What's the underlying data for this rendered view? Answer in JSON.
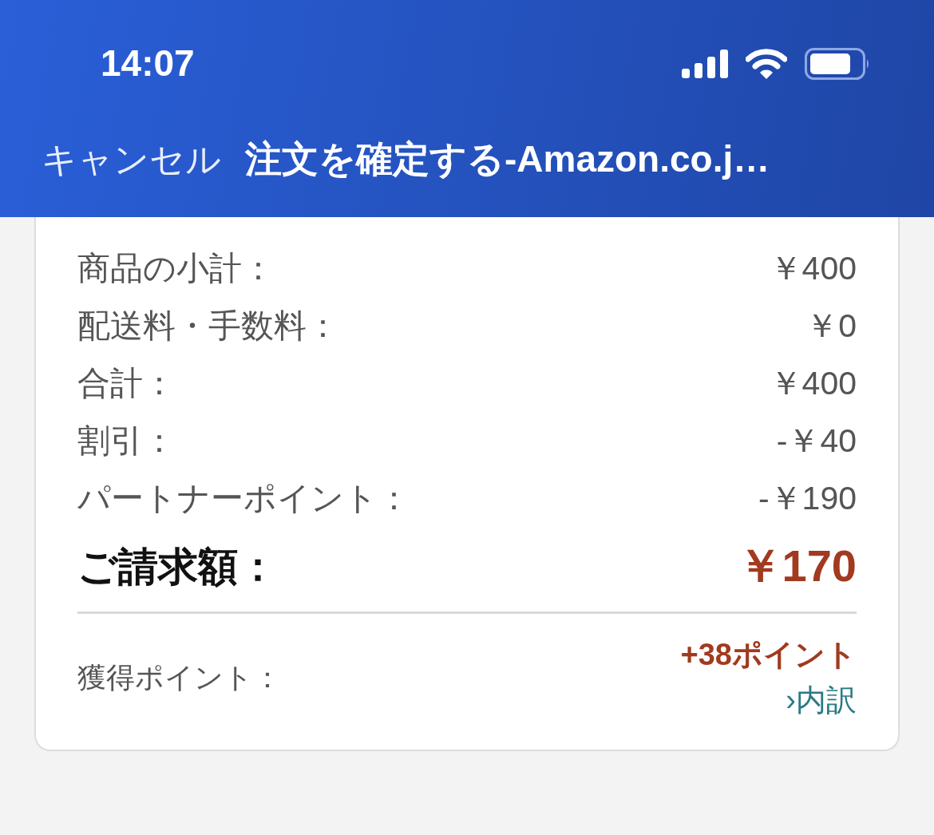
{
  "status_bar": {
    "time": "14:07"
  },
  "nav": {
    "cancel": "キャンセル",
    "title": "注文を確定する-Amazon.co.j…"
  },
  "summary": {
    "rows": [
      {
        "kind": "line",
        "label": "商品の小計：",
        "value": "￥400"
      },
      {
        "kind": "line",
        "label": "配送料・手数料：",
        "value": "￥0"
      },
      {
        "kind": "line",
        "label": "合計：",
        "value": "￥400"
      },
      {
        "kind": "line",
        "label": "割引：",
        "value": "-￥40"
      },
      {
        "kind": "line",
        "label": "パートナーポイント：",
        "value": "-￥190"
      },
      {
        "kind": "total",
        "label": "ご請求額：",
        "value": "￥170"
      }
    ],
    "points": {
      "label": "獲得ポイント：",
      "value": "+38ポイント",
      "link": "›内訳"
    }
  }
}
